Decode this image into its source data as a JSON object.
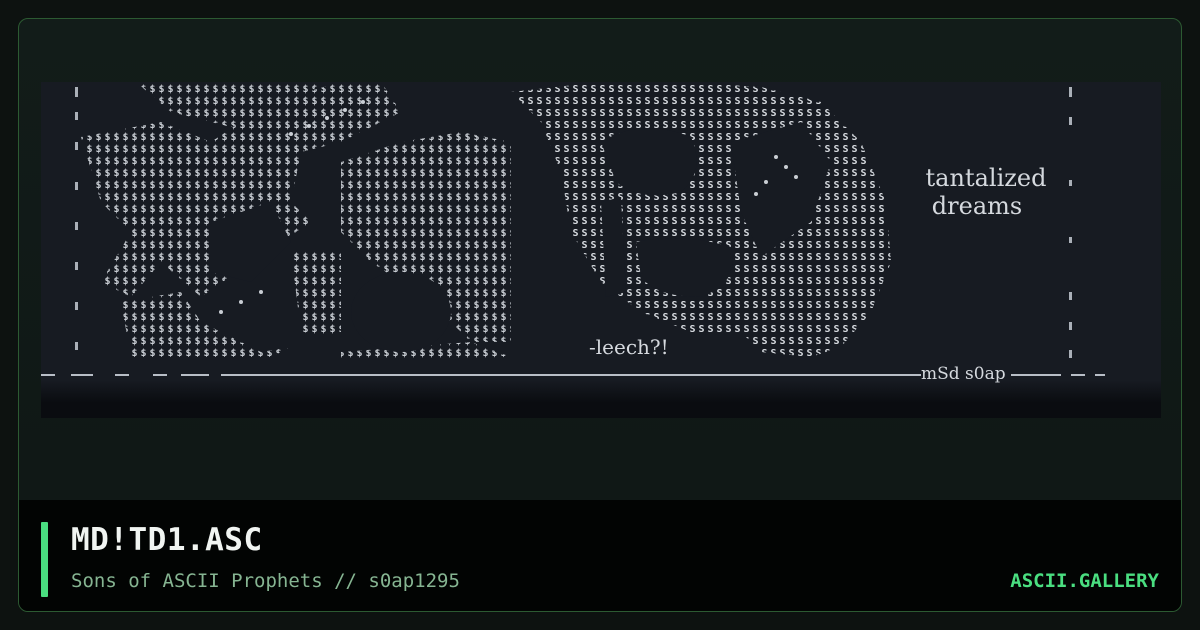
{
  "artwork": {
    "caption_line_1": "tantalized",
    "caption_line_2": "dreams",
    "bottom_tag": "-leech?!",
    "signature": "mSd s0ap"
  },
  "footer": {
    "title": "MD!TD1.ASC",
    "subtitle": "Sons of ASCII Prophets // s0ap1295",
    "brand": "ASCII.GALLERY"
  },
  "colors": {
    "accent": "#4ade80",
    "border": "#2c5a32",
    "art_background": "#171b22",
    "art_glyph": "#cfd3d8"
  }
}
